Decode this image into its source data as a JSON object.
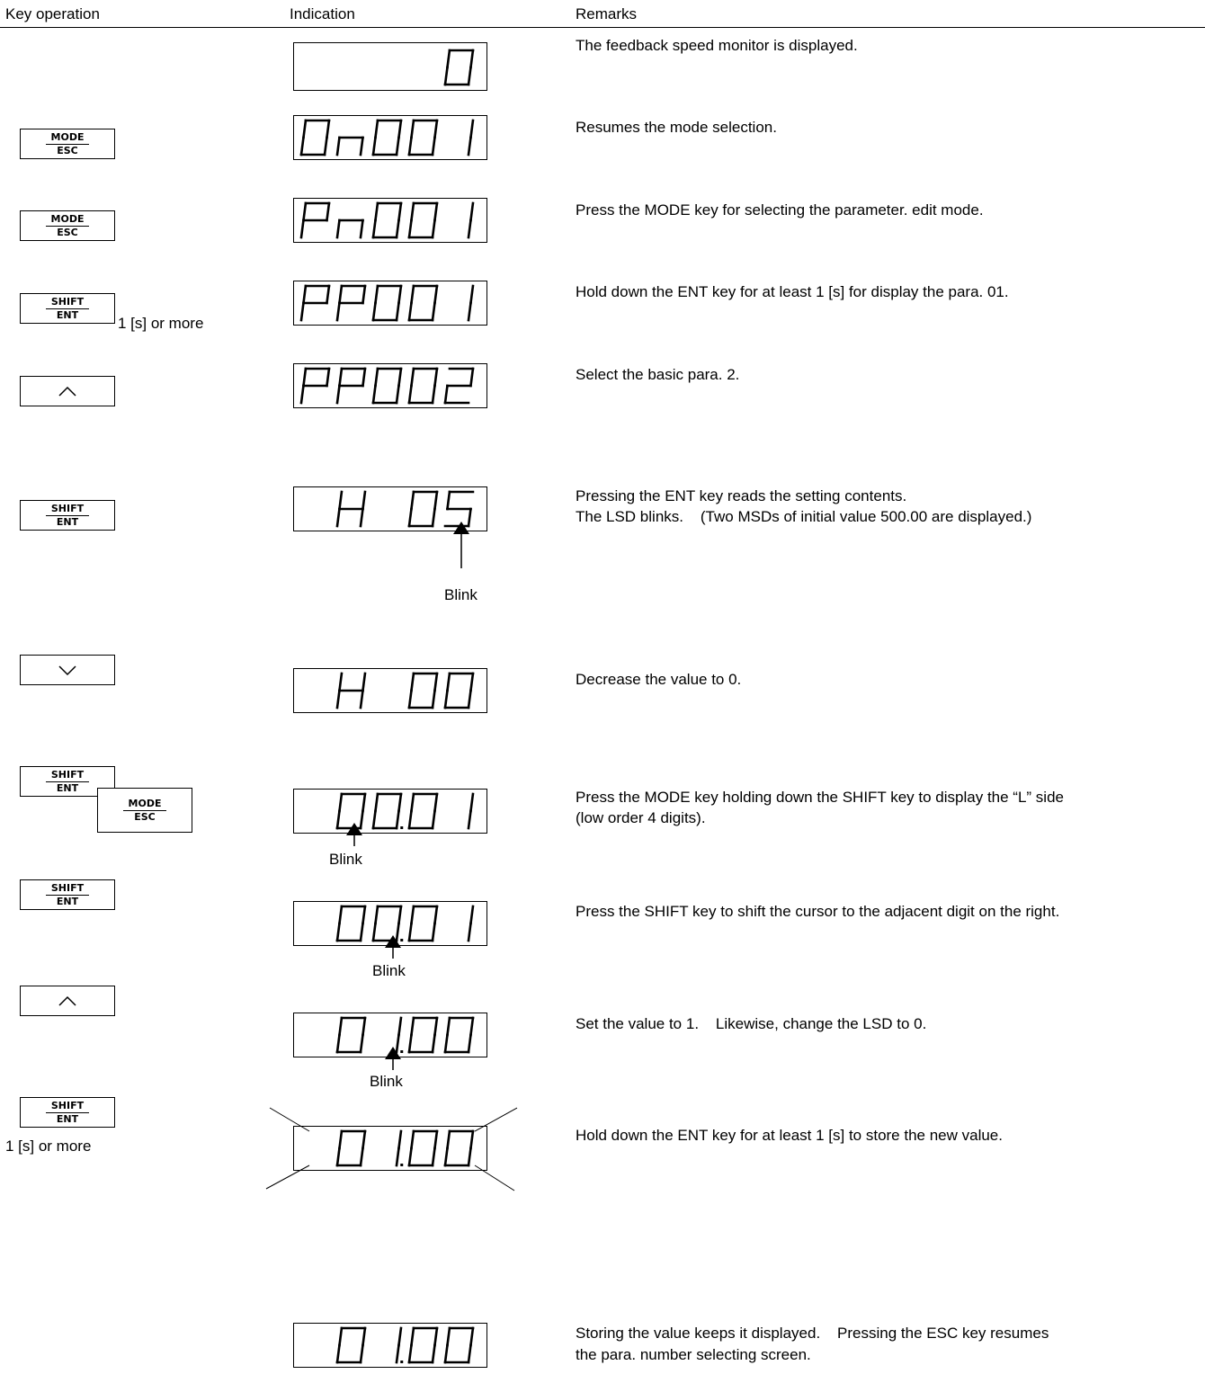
{
  "headers": {
    "key_operation": "Key operation",
    "indication": "Indication",
    "remarks": "Remarks"
  },
  "keys": {
    "mode_esc": {
      "top": "MODE",
      "bottom": "ESC"
    },
    "shift_ent": {
      "top": "SHIFT",
      "bottom": "ENT"
    },
    "up": "up-arrow-icon",
    "down": "down-arrow-icon"
  },
  "notes": {
    "hold_1s": "1 [s] or more",
    "blink": "Blink"
  },
  "displays": [
    "0",
    "On001",
    "Pn001",
    "PP001",
    "PP002",
    "H 05",
    "H 00",
    "L 00.01",
    "L 00.01",
    "L 01.00",
    "L 01.00",
    "L 01.00"
  ],
  "remarks": [
    "The feedback speed monitor is displayed.",
    "Resumes the mode selection.",
    "Press the MODE key for selecting the parameter. edit mode.",
    "Hold down the ENT key for at least 1 [s] for display the para. 01.",
    "Select the basic para. 2.",
    "Pressing the ENT key reads the setting contents.",
    "The LSD blinks.    (Two MSDs of initial value 500.00 are displayed.)",
    "Decrease the value to 0.",
    "Press the MODE key holding down the SHIFT key to display the “L” side",
    "(low order 4 digits).",
    "Press the SHIFT key to shift the cursor to the adjacent digit on the right.",
    "Set the value to 1.    Likewise, change the LSD to 0.",
    "Hold down the ENT key for at least 1 [s] to store the new value.",
    "Storing the value keeps it displayed.    Pressing the ESC key resumes",
    "the para. number selecting screen."
  ]
}
